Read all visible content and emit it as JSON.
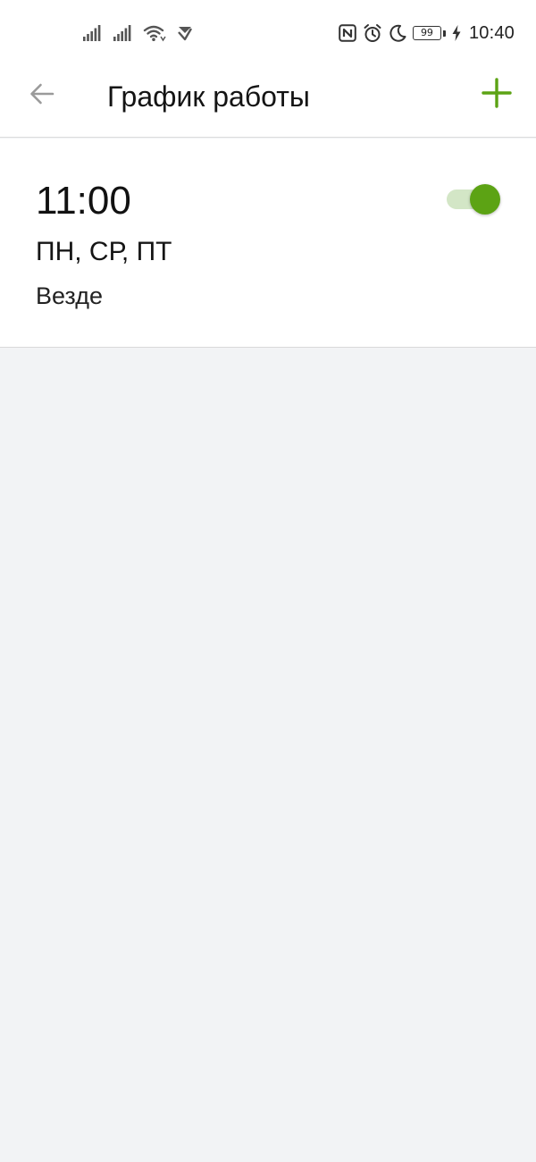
{
  "status_bar": {
    "time": "10:40",
    "battery_level": "99",
    "icons": [
      "signal-icon",
      "signal-icon",
      "wifi-icon",
      "notification-icon",
      "nfc-icon",
      "alarm-icon",
      "moon-icon",
      "battery-icon",
      "charging-icon"
    ]
  },
  "header": {
    "title": "График работы",
    "back_icon": "arrow-left-icon",
    "add_icon": "plus-icon"
  },
  "schedules": [
    {
      "time": "11:00",
      "days": "ПН, СР, ПТ",
      "location": "Везде",
      "enabled": true
    }
  ],
  "colors": {
    "accent": "#5ca314",
    "toggle_track": "#d3e6c6",
    "background": "#f2f3f5",
    "surface": "#ffffff"
  }
}
